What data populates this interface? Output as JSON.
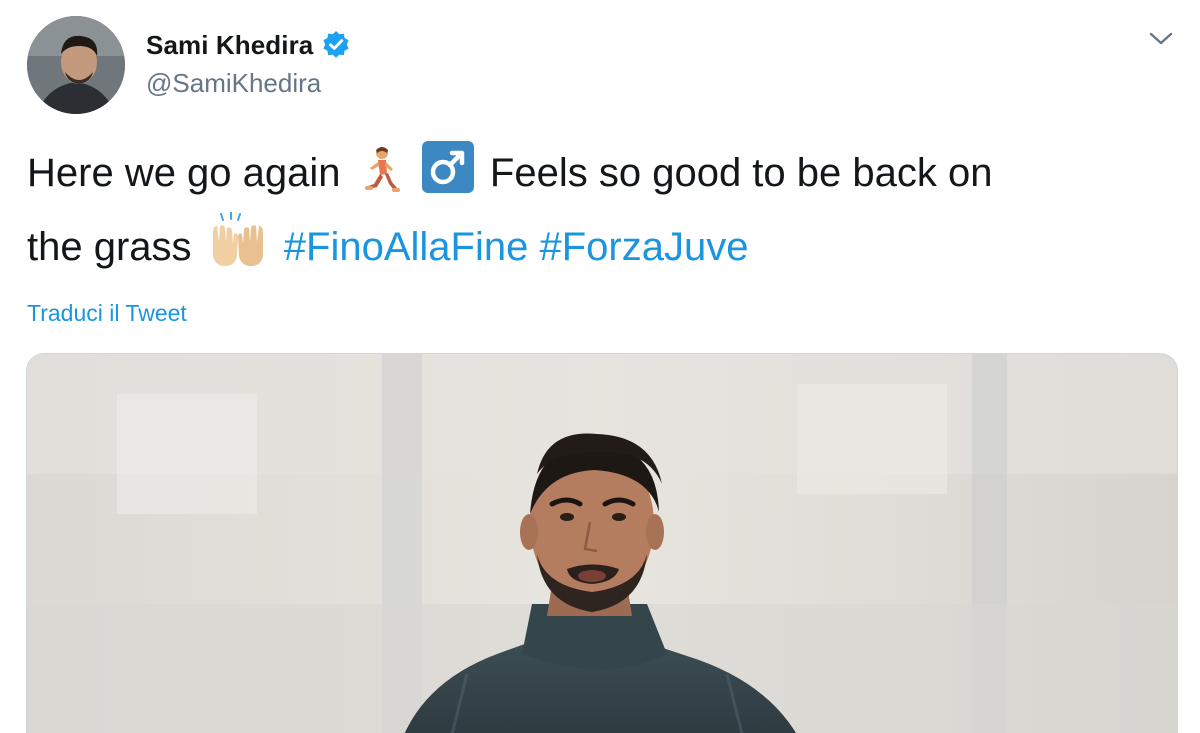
{
  "tweet": {
    "author": {
      "display_name": "Sami Khedira",
      "handle": "@SamiKhedira",
      "verified": true
    },
    "text": {
      "part1": "Here we go again",
      "part2": "Feels so good to be back on",
      "part3": "the grass",
      "hashtags": [
        "#FinoAllaFine",
        "#ForzaJuve"
      ]
    },
    "emojis": [
      "running-man-emoji",
      "male-sign-emoji",
      "raising-hands-emoji"
    ],
    "translate_label": "Traduci il Tweet",
    "icons": [
      "verified-badge-icon",
      "chevron-down-icon"
    ],
    "colors": {
      "link": "#1b95e0",
      "text": "#14171a",
      "secondary": "#657786",
      "verified": "#1da1f2"
    }
  }
}
